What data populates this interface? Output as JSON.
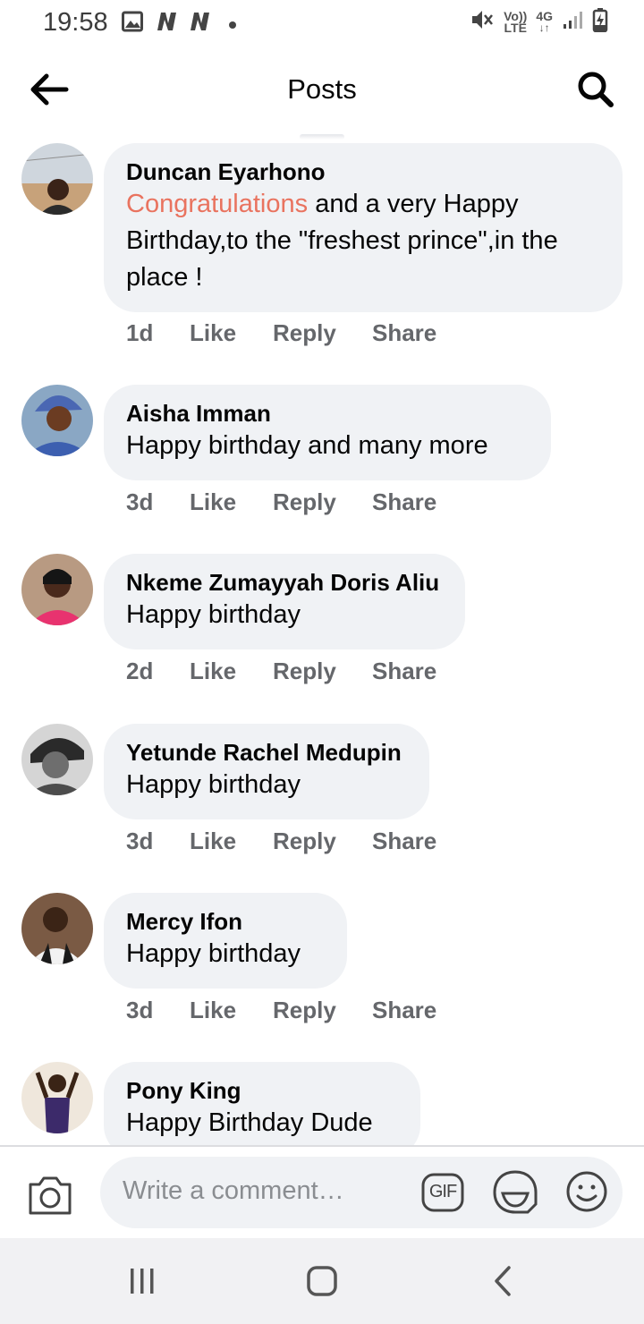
{
  "status_bar": {
    "time": "19:58",
    "left_icons": [
      "image-icon",
      "n-app-icon",
      "n-app-icon",
      "dot-icon"
    ],
    "network_top": "Vo))",
    "network_bottom": "LTE",
    "data_type": "4G",
    "data_arrows": "↓↑",
    "right_icons": [
      "mute-icon",
      "signal-icon",
      "battery-charging-icon"
    ]
  },
  "header": {
    "title": "Posts",
    "back_icon": "arrow-left-icon",
    "search_icon": "search-icon"
  },
  "comments": [
    {
      "author": "Duncan Eyarhono",
      "text_highlight": "Congratulations",
      "text": " and a very Happy Birthday,to the \"freshest prince\",in the place !",
      "time": "1d",
      "like": "Like",
      "reply": "Reply",
      "share": "Share"
    },
    {
      "author": "Aisha Imman",
      "text": "Happy birthday and many more",
      "time": "3d",
      "like": "Like",
      "reply": "Reply",
      "share": "Share"
    },
    {
      "author": "Nkeme Zumayyah Doris Aliu",
      "text": "Happy birthday",
      "time": "2d",
      "like": "Like",
      "reply": "Reply",
      "share": "Share"
    },
    {
      "author": "Yetunde Rachel Medupin",
      "text": "Happy birthday",
      "time": "3d",
      "like": "Like",
      "reply": "Reply",
      "share": "Share"
    },
    {
      "author": "Mercy Ifon",
      "text": "Happy birthday",
      "time": "3d",
      "like": "Like",
      "reply": "Reply",
      "share": "Share"
    },
    {
      "author": "Pony King",
      "text": "Happy Birthday Dude"
    }
  ],
  "composer": {
    "placeholder": "Write a comment…",
    "camera_icon": "camera-icon",
    "gif_label": "GIF",
    "sticker_icon": "sticker-icon",
    "emoji_icon": "emoji-icon"
  },
  "nav_bar": {
    "icons": [
      "recent-apps-icon",
      "home-icon",
      "back-icon"
    ]
  },
  "colors": {
    "highlight": "#e9735f",
    "bubble": "#f0f2f5",
    "meta_text": "#65676b",
    "placeholder": "#8a8d91"
  }
}
